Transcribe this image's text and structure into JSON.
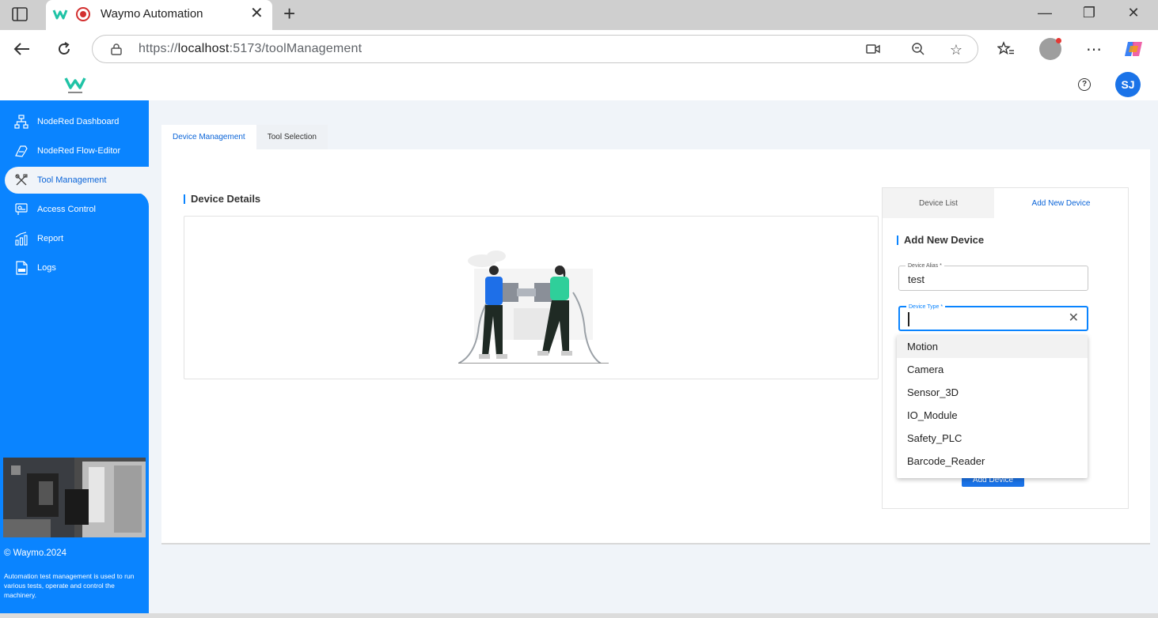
{
  "browser": {
    "tab_title": "Waymo Automation",
    "url_scheme": "https://",
    "url_host": "localhost",
    "url_rest": ":5173/toolManagement"
  },
  "header": {
    "avatar_initials": "SJ"
  },
  "sidebar": {
    "items": [
      {
        "label": "NodeRed Dashboard",
        "icon": "sitemap-icon"
      },
      {
        "label": "NodeRed Flow-Editor",
        "icon": "flow-editor-icon"
      },
      {
        "label": "Tool Management",
        "icon": "tools-icon",
        "active": true
      },
      {
        "label": "Access Control",
        "icon": "access-control-icon"
      },
      {
        "label": "Report",
        "icon": "report-chart-icon"
      },
      {
        "label": "Logs",
        "icon": "logs-icon"
      }
    ],
    "copyright": "© Waymo.2024",
    "description": "Automation test management is used to run various tests, operate and control the machinery."
  },
  "main": {
    "tabs": [
      {
        "label": "Device Management",
        "active": true
      },
      {
        "label": "Tool Selection",
        "active": false
      }
    ],
    "details_title": "Device Details"
  },
  "panel": {
    "tabs": [
      {
        "label": "Device List",
        "active": false
      },
      {
        "label": "Add New Device",
        "active": true
      }
    ],
    "title": "Add New Device",
    "alias_label": "Device Alias *",
    "alias_value": "test",
    "type_label": "Device Type *",
    "type_value": "",
    "submit_label": "Add Device"
  },
  "dropdown": {
    "options": [
      "Motion",
      "Camera",
      "Sensor_3D",
      "IO_Module",
      "Safety_PLC",
      "Barcode_Reader"
    ],
    "highlighted": "Motion"
  },
  "colors": {
    "accent": "#0a84ff",
    "sidebar": "#0a84ff",
    "link": "#0a64d8"
  }
}
